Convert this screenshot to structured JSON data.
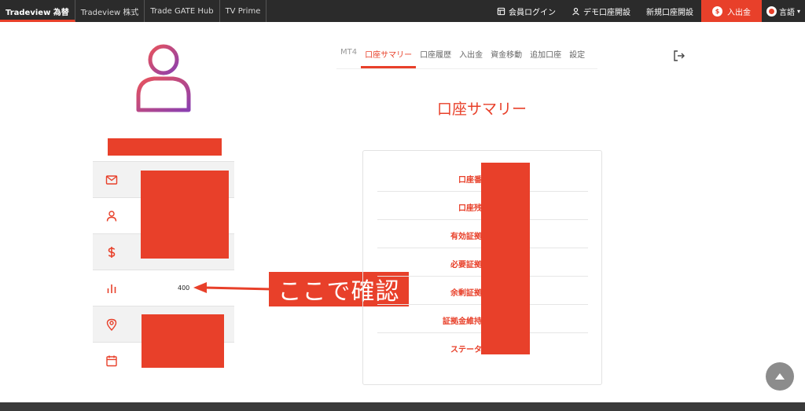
{
  "topnav": {
    "tabs": [
      "Tradeview 為替",
      "Tradeview 株式",
      "Trade GATE Hub",
      "TV Prime"
    ],
    "login": "会員ログイン",
    "demo": "デモ口座開設",
    "new_account": "新規口座開設",
    "deposit": "入出金",
    "deposit_coin": "$",
    "language": "言語",
    "language_caret": "▾"
  },
  "profile": {
    "rows": [
      {
        "icon": "mail-icon",
        "value": ""
      },
      {
        "icon": "user-icon",
        "value": ""
      },
      {
        "icon": "dollar-icon",
        "value": ""
      },
      {
        "icon": "bar-chart-icon",
        "value": "400"
      },
      {
        "icon": "location-pin-icon",
        "value": ""
      },
      {
        "icon": "calendar-icon",
        "value": ""
      }
    ]
  },
  "annotation": {
    "text": "ここで確認"
  },
  "account_tabs": [
    "MT4",
    "口座サマリー",
    "口座履歴",
    "入出金",
    "資金移動",
    "追加口座",
    "設定"
  ],
  "section_title": "口座サマリー",
  "summary": {
    "labels": [
      "口座番号",
      "口座残高",
      "有効証拠金",
      "必要証拠金",
      "余剰証拠金",
      "証拠金維持率",
      "ステータス"
    ]
  },
  "colors": {
    "accent": "#e8402a",
    "nav_bg": "#2b2b2b",
    "avatar_gradient": [
      "#e8535c",
      "#8a3fb0"
    ]
  }
}
